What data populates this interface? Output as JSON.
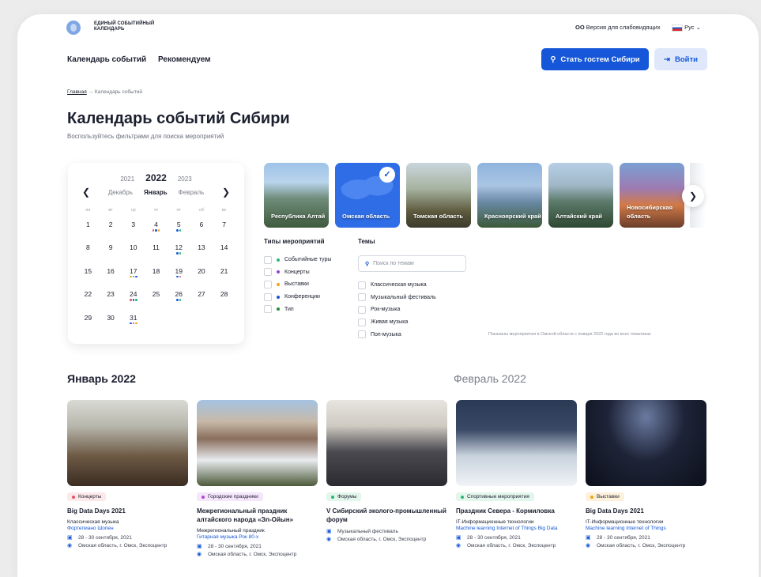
{
  "header": {
    "logo_text": "ЕДИНЫЙ СОБЫТИЙНЫЙ КАЛЕНДАРЬ",
    "accessibility": "Версия для слабовидящих",
    "language": "Рус"
  },
  "nav": {
    "items": [
      "Календарь событий",
      "Рекомендуем"
    ]
  },
  "actions": {
    "guest_button": "Стать гостем Сибири",
    "login_button": "Войти"
  },
  "breadcrumb": {
    "home": "Главная",
    "current": "Календарь событий"
  },
  "page": {
    "title": "Календарь событий Сибири",
    "subtitle": "Воспользуйтесь фильтрами для поиска мероприятий"
  },
  "calendar": {
    "years": [
      "2021",
      "2022",
      "2023"
    ],
    "months": [
      "Декабрь",
      "Январь",
      "Февраль"
    ],
    "weekdays": [
      "пн",
      "вт",
      "ср",
      "чт",
      "пт",
      "сб",
      "вс"
    ],
    "days": [
      "1",
      "2",
      "3",
      "4",
      "5",
      "6",
      "7",
      "8",
      "9",
      "10",
      "11",
      "12",
      "13",
      "14",
      "15",
      "16",
      "17",
      "18",
      "19",
      "20",
      "21",
      "22",
      "23",
      "24",
      "25",
      "26",
      "27",
      "28",
      "29",
      "30",
      "31"
    ]
  },
  "regions": [
    {
      "name": "Республика Алтай",
      "selected": false
    },
    {
      "name": "Омская область",
      "selected": true
    },
    {
      "name": "Томская область",
      "selected": false
    },
    {
      "name": "Красноярский край",
      "selected": false
    },
    {
      "name": "Алтайский край",
      "selected": false
    },
    {
      "name": "Новосибирская область",
      "selected": false
    }
  ],
  "filters": {
    "types_title": "Типы мероприятий",
    "types": [
      {
        "label": "Событийные туры",
        "color": "#2bb673"
      },
      {
        "label": "Концерты",
        "color": "#9b3fd6"
      },
      {
        "label": "Выставки",
        "color": "#f2a413"
      },
      {
        "label": "Конференции",
        "color": "#1557d8"
      },
      {
        "label": "Тип",
        "color": "#1d8f3c"
      }
    ],
    "themes_title": "Темы",
    "search_placeholder": "Поиск по темам",
    "themes": [
      "Классическая музыка",
      "Музыкальный фестиваль",
      "Рок-музыка",
      "Живая музыка",
      "Поп-музыка"
    ],
    "note": "Показаны мероприятия в Омской области с января 2022 года во всех тематиках"
  },
  "months_headers": [
    "Январь 2022",
    "Февраль 2022"
  ],
  "events": [
    {
      "tag": "Концерты",
      "tag_color": "#e0556a",
      "tag_bg": "#fde8ea",
      "title": "Big Data Days 2021",
      "subtitle": "Классическая музыка",
      "tags": "Фортепиано  Шопен",
      "date": "28 - 30 сентября, 2021",
      "place": "Омская область, г. Омск, Экспоцентр"
    },
    {
      "tag": "Городские праздники",
      "tag_color": "#b04ad6",
      "tag_bg": "#f5e6fb",
      "title": "Межрегиональный праздник алтайского народа «Эл-Ойын»",
      "subtitle": "Межрегиональный праздник",
      "tags": "Гитарная музыка  Рок 80-х",
      "date": "28 - 30 сентября, 2021",
      "place": "Омская область, г. Омск, Экспоцентр"
    },
    {
      "tag": "Форумы",
      "tag_color": "#2bb673",
      "tag_bg": "#e3f6ec",
      "title": "V Сибирский эколого-промышленный форум",
      "subtitle": "",
      "tags": "",
      "date": "Музыкальный фестиваль",
      "place": "Омская область, г. Омск, Экспоцентр"
    },
    {
      "tag": "Спортивные мероприятия",
      "tag_color": "#2bb673",
      "tag_bg": "#e3f6ec",
      "title": "Праздник Севера - Кормиловка",
      "subtitle": "IT-Информационные технологии",
      "tags": "Machine learning  Internet of Things  Big Data",
      "date": "28 - 30 сентября, 2021",
      "place": "Омская область, г. Омск, Экспоцентр"
    },
    {
      "tag": "Выставки",
      "tag_color": "#f2a413",
      "tag_bg": "#fdf1dc",
      "title": "Big Data Days 2021",
      "subtitle": "IT-Информационные технологии",
      "tags": "Machine learning  Internet of Things",
      "date": "28 - 30 сентября, 2021",
      "place": "Омская область, г. Омск, Экспоцентр"
    }
  ]
}
